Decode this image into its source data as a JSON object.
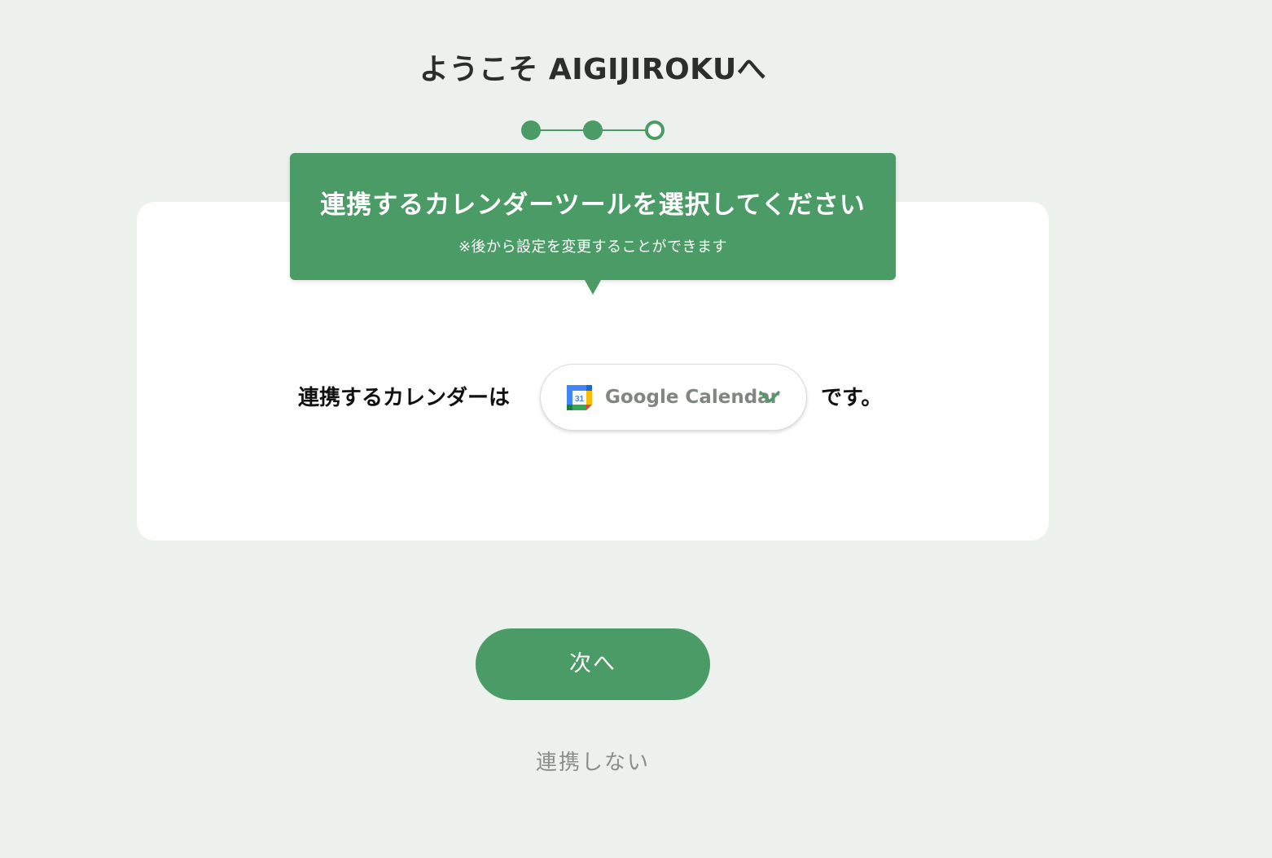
{
  "header": {
    "title": "ようこそ AIGIJIROKUへ"
  },
  "stepper": {
    "total_steps": 3,
    "completed_steps": 2,
    "current_step": 3
  },
  "callout": {
    "title": "連携するカレンダーツールを選択してください",
    "note": "※後から設定を変更することができます"
  },
  "calendar_select": {
    "prefix": "連携するカレンダーは",
    "selected_value": "Google Calendar",
    "icon_day": "31",
    "suffix": "です。"
  },
  "actions": {
    "next_label": "次へ",
    "skip_label": "連携しない"
  },
  "colors": {
    "accent": "#4a9b65",
    "background": "#ecf1ed",
    "card": "#ffffff",
    "muted_text": "#8a8f8b"
  }
}
